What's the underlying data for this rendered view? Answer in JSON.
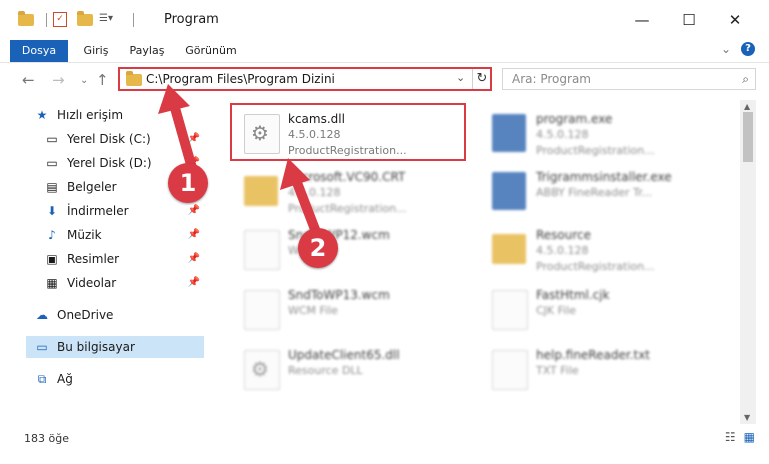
{
  "window": {
    "title": "Program",
    "controls": {
      "minimize": "—",
      "maximize": "☐",
      "close": "✕"
    }
  },
  "ribbon": {
    "tabs": [
      "Dosya",
      "Giriş",
      "Paylaş",
      "Görünüm"
    ],
    "expand_icon": "chevron-down-icon",
    "help_label": "?"
  },
  "address": {
    "path": "C:\\Program Files\\Program Dizini",
    "dropdown_glyph": "⌄",
    "refresh_glyph": "↻"
  },
  "search": {
    "placeholder": "Ara: Program",
    "icon": "search-icon"
  },
  "nav": {
    "back": "←",
    "forward": "→",
    "recent": "⌄",
    "up": "↑"
  },
  "sidebar": {
    "items": [
      {
        "label": "Hızlı erişim",
        "icon": "star-icon",
        "pinned": false
      },
      {
        "label": "Yerel Disk (C:)",
        "icon": "drive-icon",
        "pinned": true
      },
      {
        "label": "Yerel Disk (D:)",
        "icon": "drive-icon",
        "pinned": true
      },
      {
        "label": "Belgeler",
        "icon": "documents-icon",
        "pinned": true
      },
      {
        "label": "İndirmeler",
        "icon": "download-icon",
        "pinned": true
      },
      {
        "label": "Müzik",
        "icon": "music-icon",
        "pinned": true
      },
      {
        "label": "Resimler",
        "icon": "pictures-icon",
        "pinned": true
      },
      {
        "label": "Videolar",
        "icon": "videos-icon",
        "pinned": true
      },
      {
        "label": "OneDrive",
        "icon": "cloud-icon",
        "pinned": false
      },
      {
        "label": "Bu bilgisayar",
        "icon": "computer-icon",
        "pinned": false
      },
      {
        "label": "Ağ",
        "icon": "network-icon",
        "pinned": false
      }
    ]
  },
  "files": [
    {
      "name": "kcams.dll",
      "line1": "4.5.0.128",
      "line2": "ProductRegistration...",
      "icon": "dll-gear-icon",
      "highlighted": true
    },
    {
      "name": "program.exe",
      "line1": "4.5.0.128",
      "line2": "ProductRegistration...",
      "icon": "exe-icon",
      "highlighted": false
    },
    {
      "name": "Microsoft.VC90.CRT",
      "line1": "4.5.0.128",
      "line2": "ProductRegistration...",
      "icon": "folder-icon",
      "highlighted": false
    },
    {
      "name": "Trigrammsinstaller.exe",
      "line1": "ABBY FineReader Tr...",
      "line2": "",
      "icon": "exe-icon",
      "highlighted": false
    },
    {
      "name": "SndToWP12.wcm",
      "line1": "WCM File",
      "line2": "",
      "icon": "file-icon",
      "highlighted": false
    },
    {
      "name": "Resource",
      "line1": "4.5.0.128",
      "line2": "ProductRegistration...",
      "icon": "folder-icon",
      "highlighted": false
    },
    {
      "name": "SndToWP13.wcm",
      "line1": "WCM File",
      "line2": "",
      "icon": "file-icon",
      "highlighted": false
    },
    {
      "name": "FastHtml.cjk",
      "line1": "CJK File",
      "line2": "",
      "icon": "file-icon",
      "highlighted": false
    },
    {
      "name": "UpdateClient65.dll",
      "line1": "Resource DLL",
      "line2": "",
      "icon": "dll-gear-icon",
      "highlighted": false
    },
    {
      "name": "help.fineReader.txt",
      "line1": "TXT File",
      "line2": "",
      "icon": "file-icon",
      "highlighted": false
    }
  ],
  "status": {
    "count": "183 öğe"
  },
  "annotations": {
    "one": "1",
    "two": "2",
    "color": "#d93a44"
  }
}
